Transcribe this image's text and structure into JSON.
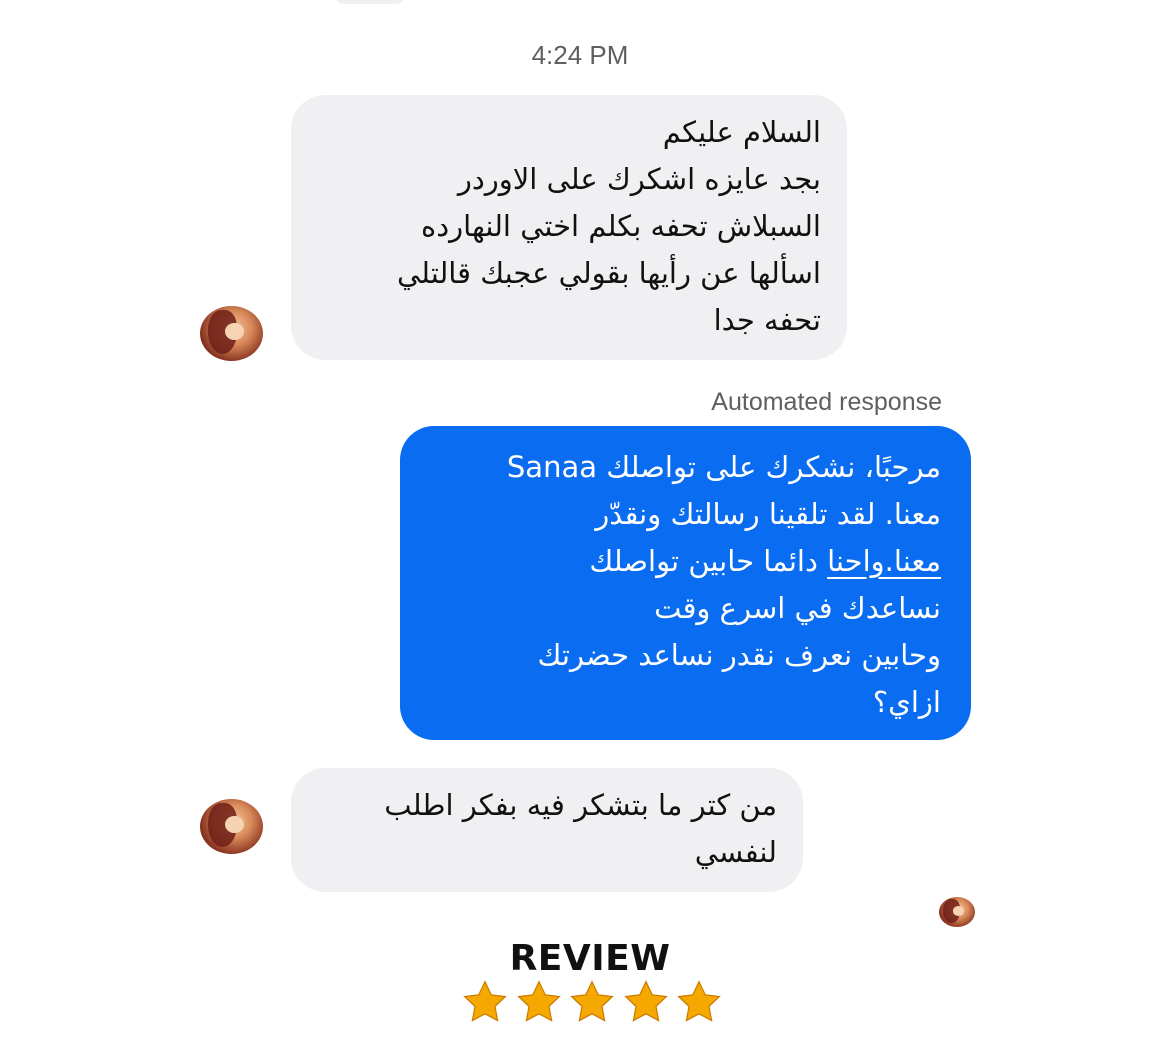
{
  "conversation": {
    "timestamp": "4:24 PM",
    "messages": [
      {
        "sender": "customer",
        "lines": [
          "السلام عليكم",
          "بجد عايزه اشكرك على الاوردر",
          "السبلاش تحفه بكلم اختي النهارده",
          "اسألها عن رأيها بقولي عجبك قالتلي",
          "تحفه جدا"
        ]
      },
      {
        "sender": "page",
        "label": "Automated response",
        "lines": [
          "مرحبًا، نشكرك على تواصلك Sanaa",
          "معنا. لقد تلقينا رسالتك ونقدّر",
          "دائما حابين تواصلك",
          "نساعدك في اسرع وقت",
          "وحابين نعرف نقدر نساعد حضرتك",
          "ازاي؟"
        ],
        "underlined_text": "معنا.واحنا"
      },
      {
        "sender": "customer",
        "lines": [
          "من كتر ما بتشكر فيه بفكر اطلب",
          "لنفسي"
        ]
      }
    ]
  },
  "review": {
    "title": "REVIEW",
    "rating": 5,
    "max_rating": 5,
    "star_color": "#f5a800",
    "star_outline_color": "#c97a00"
  },
  "colors": {
    "incoming_bubble": "#f0f0f3",
    "outgoing_bubble": "#0a6cf0",
    "meta_text": "#5f5f63"
  }
}
